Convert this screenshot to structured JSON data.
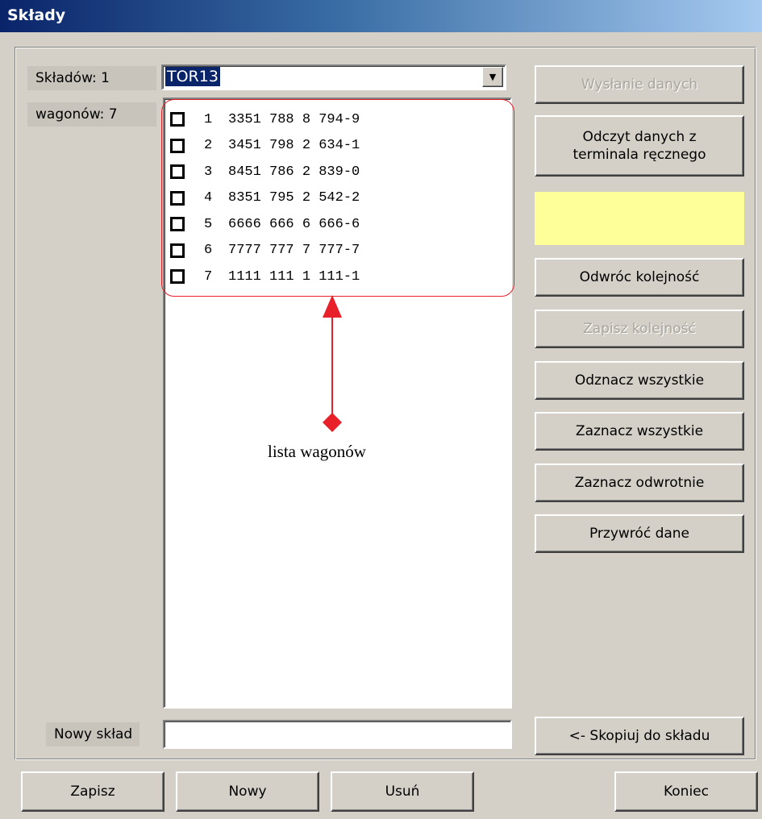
{
  "window": {
    "title": "Składy"
  },
  "labels": {
    "sklady_count": "Składów: 1",
    "wagony_count": "wagonów: 7",
    "nowy_sklad": "Nowy skład"
  },
  "combo": {
    "value": "TOR13"
  },
  "wagons": [
    {
      "num": "1",
      "id": "3351 788 8 794-9"
    },
    {
      "num": "2",
      "id": "3451 798 2 634-1"
    },
    {
      "num": "3",
      "id": "8451 786 2 839-0"
    },
    {
      "num": "4",
      "id": "8351 795 2 542-2"
    },
    {
      "num": "5",
      "id": "6666 666 6 666-6"
    },
    {
      "num": "6",
      "id": "7777 777 7 777-7"
    },
    {
      "num": "7",
      "id": "1111 111 1 111-1"
    }
  ],
  "buttons": {
    "wyslanie": "Wysłanie danych",
    "odczyt_line1": "Odczyt danych z",
    "odczyt_line2": "terminala ręcznego",
    "odwroc": "Odwróc kolejność",
    "zapisz_kolejnosc": "Zapisz kolejność",
    "odznacz": "Odznacz wszystkie",
    "zaznacz": "Zaznacz wszystkie",
    "zaznacz_odwrotnie": "Zaznacz odwrotnie",
    "przywroc": "Przywróć dane",
    "skopiuj": "<- Skopiuj do składu",
    "zapisz": "Zapisz",
    "nowy": "Nowy",
    "usun": "Usuń",
    "koniec": "Koniec"
  },
  "annotation": {
    "text": "lista wagonów",
    "color": "#e8202a"
  },
  "colors": {
    "highlight_panel": "#ffff99",
    "title_gradient_start": "#0a246a"
  }
}
